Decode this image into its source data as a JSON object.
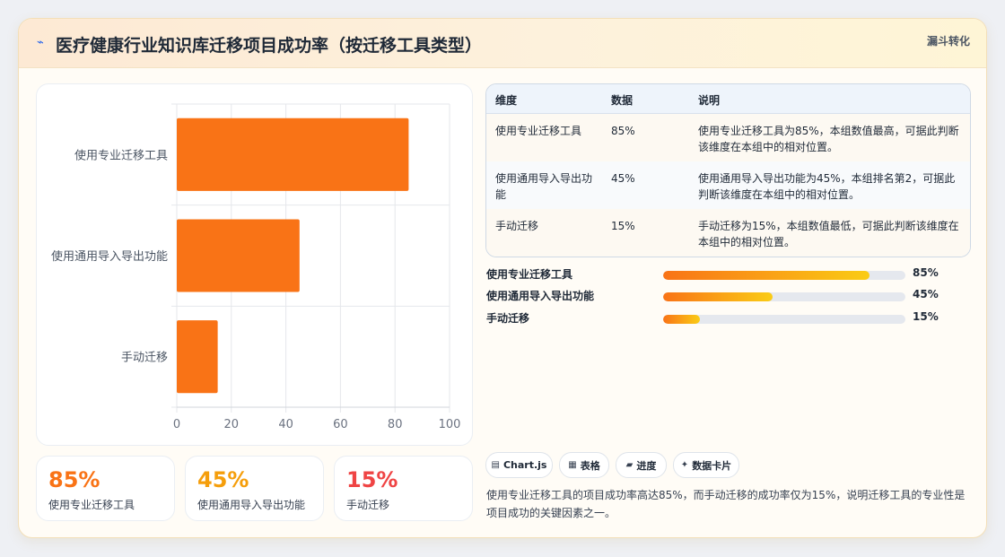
{
  "header": {
    "title": "医疗健康行业知识库迁移项目成功率（按迁移工具类型）",
    "badge": "漏斗转化"
  },
  "icons": {
    "title_icon": "bolt-icon"
  },
  "colors": {
    "bar": "#f97316",
    "accent_orange": "#f97316",
    "accent_amber": "#f59e0b",
    "accent_red": "#ef4444"
  },
  "chart_data": {
    "type": "bar",
    "orientation": "horizontal",
    "categories": [
      "使用专业迁移工具",
      "使用通用导入导出功能",
      "手动迁移"
    ],
    "values": [
      85,
      45,
      15
    ],
    "xlim": [
      0,
      100
    ],
    "xticks": [
      "0",
      "20",
      "40",
      "60",
      "80",
      "100"
    ],
    "grid": true,
    "title": "",
    "xlabel": "",
    "ylabel": ""
  },
  "stats": [
    {
      "value": "85%",
      "label": "使用专业迁移工具",
      "color": "#f97316"
    },
    {
      "value": "45%",
      "label": "使用通用导入导出功能",
      "color": "#f59e0b"
    },
    {
      "value": "15%",
      "label": "手动迁移",
      "color": "#ef4444"
    }
  ],
  "table": {
    "headers": [
      "维度",
      "数据",
      "说明"
    ],
    "rows": [
      {
        "dimension": "使用专业迁移工具",
        "data": "85%",
        "note": "使用专业迁移工具为85%，本组数值最高，可据此判断该维度在本组中的相对位置。"
      },
      {
        "dimension": "使用通用导入导出功能",
        "data": "45%",
        "note": "使用通用导入导出功能为45%，本组排名第2，可据此判断该维度在本组中的相对位置。"
      },
      {
        "dimension": "手动迁移",
        "data": "15%",
        "note": "手动迁移为15%，本组数值最低，可据此判断该维度在本组中的相对位置。"
      }
    ]
  },
  "progress": [
    {
      "label": "使用专业迁移工具",
      "value": 85,
      "value_text": "85%"
    },
    {
      "label": "使用通用导入导出功能",
      "value": 45,
      "value_text": "45%"
    },
    {
      "label": "手动迁移",
      "value": 15,
      "value_text": "15%"
    }
  ],
  "chips": [
    {
      "icon": "▤",
      "icon_name": "chart-icon",
      "label": "Chart.js"
    },
    {
      "icon": "▦",
      "icon_name": "table-icon",
      "label": "表格"
    },
    {
      "icon": "▰",
      "icon_name": "progress-icon",
      "label": "进度"
    },
    {
      "icon": "✦",
      "icon_name": "sparkle-icon",
      "label": "数据卡片"
    }
  ],
  "summary": "使用专业迁移工具的项目成功率高达85%，而手动迁移的成功率仅为15%，说明迁移工具的专业性是项目成功的关键因素之一。"
}
